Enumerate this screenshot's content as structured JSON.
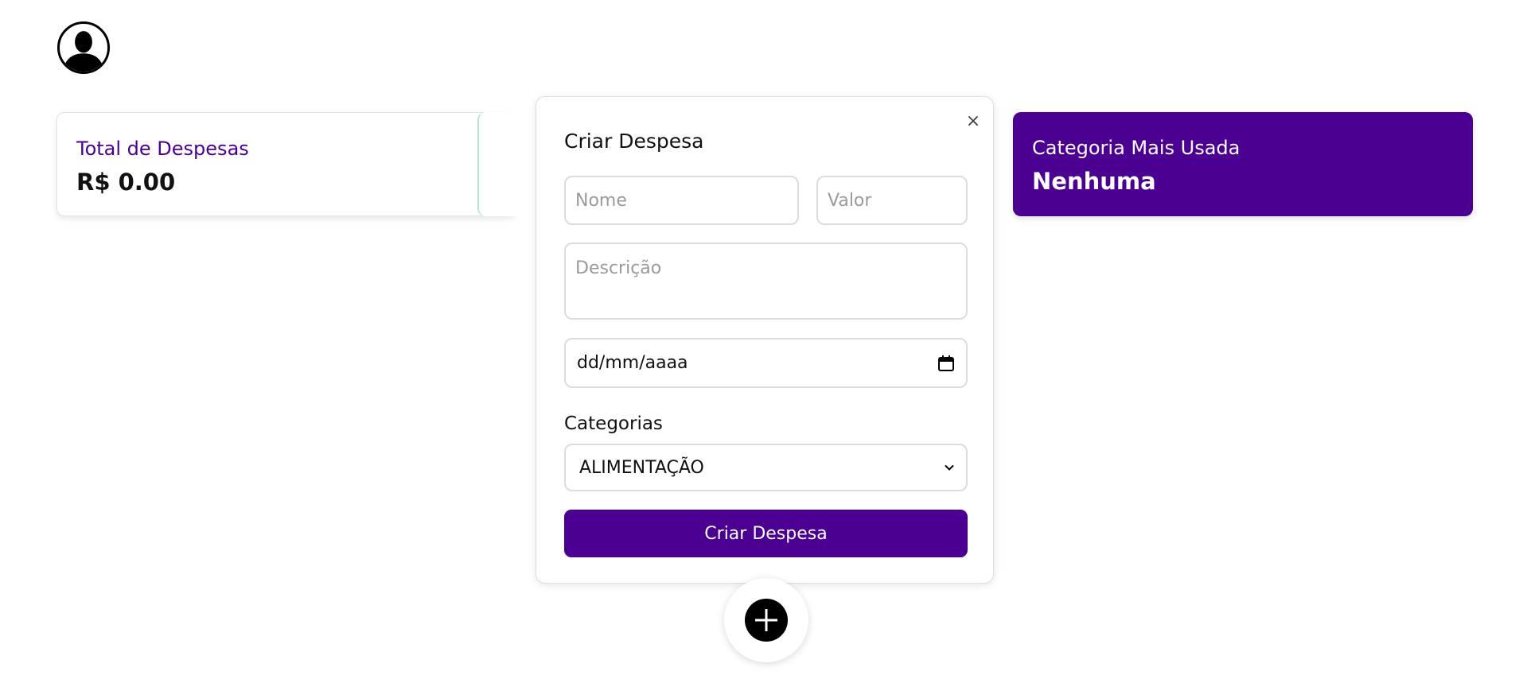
{
  "header": {
    "avatar_icon": "user-silhouette-icon"
  },
  "summary": {
    "total_label": "Total de Despesas",
    "total_value": "R$ 0.00",
    "category_label": "Categoria Mais Usada",
    "category_value": "Nenhuma"
  },
  "modal": {
    "title": "Criar Despesa",
    "close_label": "×",
    "name_placeholder": "Nome",
    "value_placeholder": "Valor",
    "description_placeholder": "Descrição",
    "date_placeholder": "dd/mm/aaaa",
    "categories_label": "Categorias",
    "selected_category": "ALIMENTAÇÃO",
    "submit_label": "Criar Despesa"
  },
  "fab": {
    "icon": "plus-icon"
  },
  "colors": {
    "accent": "#4b0092",
    "text": "#111111",
    "border": "#dcdcdc",
    "placeholder": "#9a9a9a",
    "teal_edge": "#b9e3d9"
  }
}
